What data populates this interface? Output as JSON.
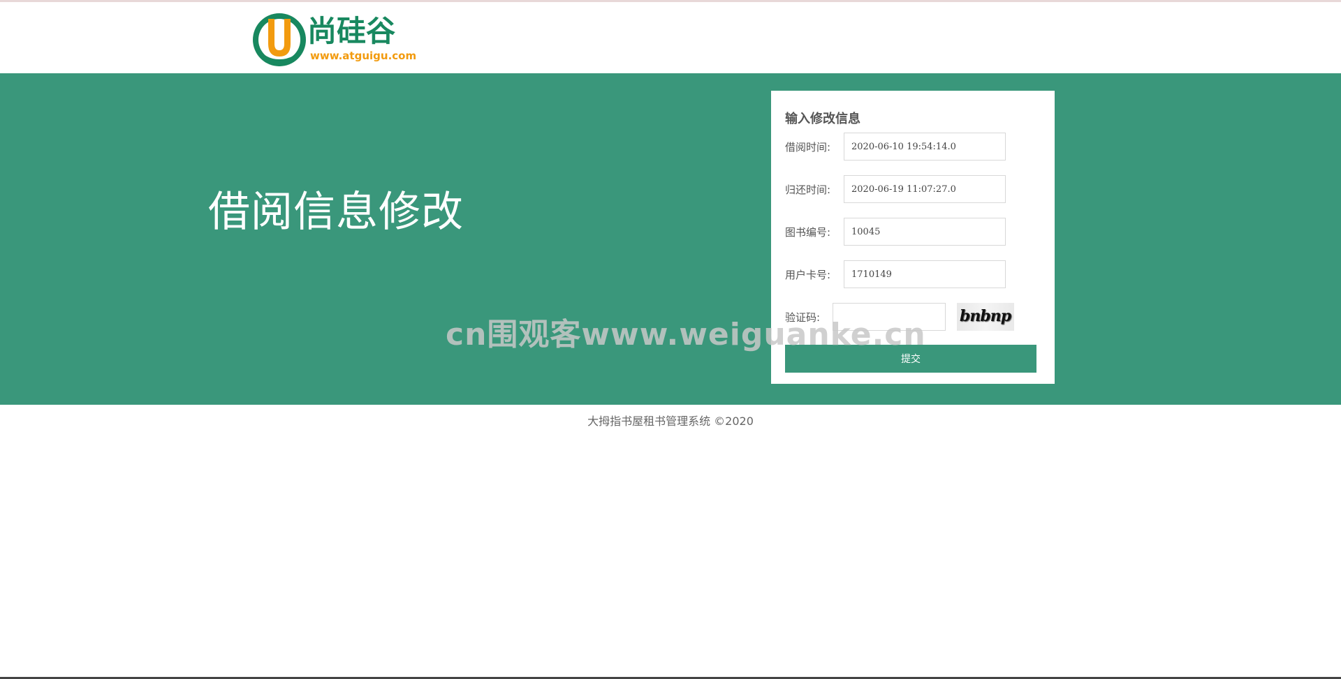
{
  "brand": {
    "logo_text": "尚硅谷",
    "logo_url_text": "www.atguigu.com",
    "logo_letter": "U",
    "colors": {
      "green": "#18885f",
      "orange": "#f29b0f"
    }
  },
  "banner": {
    "heading": "借阅信息修改",
    "color": "#3a977b"
  },
  "form": {
    "title": "输入修改信息",
    "borrow_time": {
      "label": "借阅时间:",
      "value": "2020-06-10 19:54:14.0"
    },
    "return_time": {
      "label": "归还时间:",
      "value": "2020-06-19 11:07:27.0"
    },
    "book_id": {
      "label": "图书编号:",
      "value": "10045"
    },
    "card_no": {
      "label": "用户卡号:",
      "value": "1710149"
    },
    "captcha": {
      "label": "验证码:",
      "value": "",
      "image_text": "bnbnp"
    },
    "submit_label": "提交"
  },
  "watermark": "cn围观客www.weiguanke.cn",
  "footer": "大拇指书屋租书管理系统 ©2020"
}
